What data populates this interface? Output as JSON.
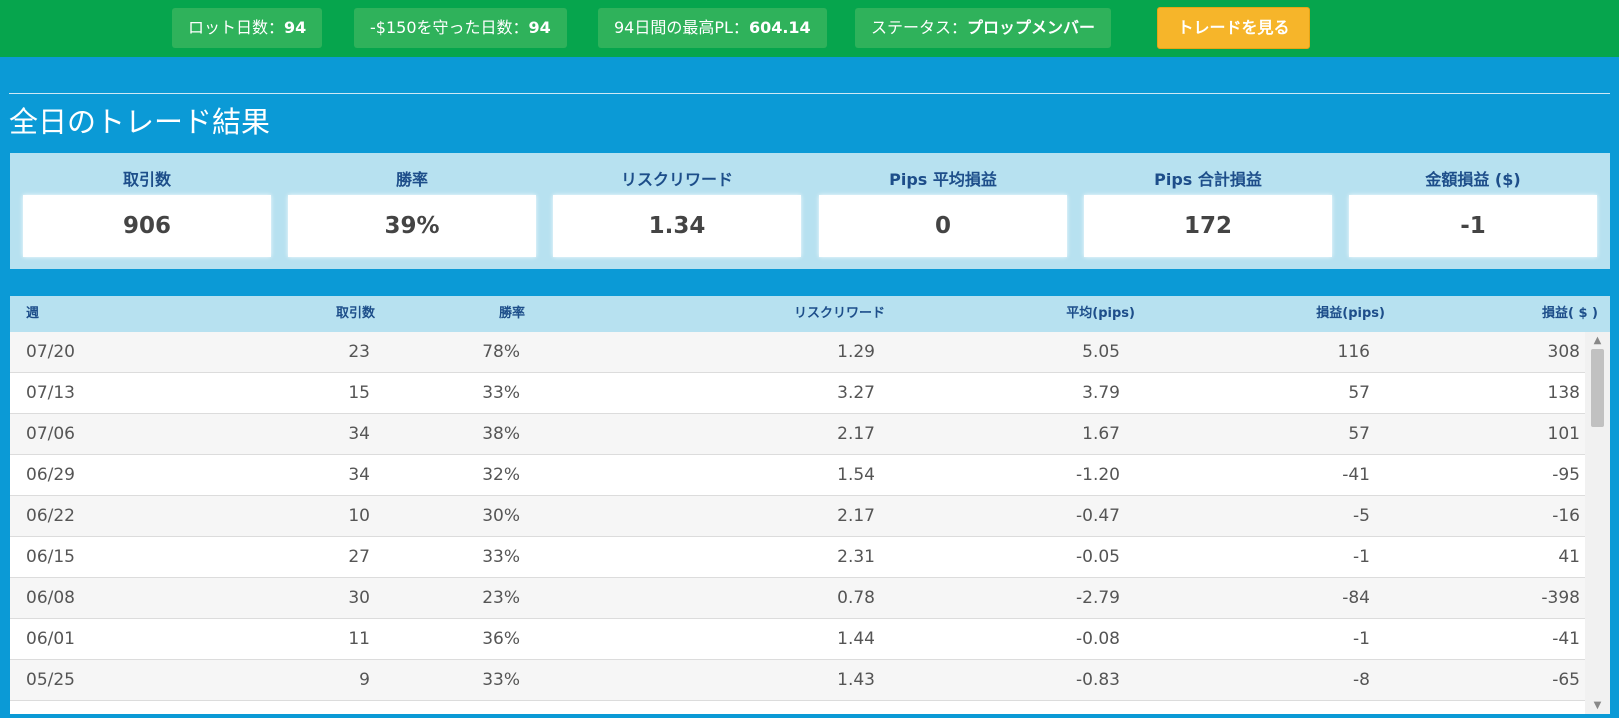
{
  "topbar": {
    "lot_days": {
      "label": "ロット日数：",
      "value": "94"
    },
    "protected_days": {
      "label": "-$150を守った日数：",
      "value": "94"
    },
    "best_pl": {
      "label_prefix": "94日間の最高PL：",
      "value": "604.14"
    },
    "status": {
      "label": "ステータス：",
      "value": "プロップメンバー"
    },
    "view_trades_label": "トレードを見る"
  },
  "section_title": "全日のトレード結果",
  "stats": [
    {
      "label": "取引数",
      "value": "906"
    },
    {
      "label": "勝率",
      "value": "39%"
    },
    {
      "label": "リスクリワード",
      "value": "1.34"
    },
    {
      "label": "Pips 平均損益",
      "value": "0"
    },
    {
      "label": "Pips 合計損益",
      "value": "172"
    },
    {
      "label": "金額損益 ($)",
      "value": "-1"
    }
  ],
  "table": {
    "headers": [
      "週",
      "取引数",
      "勝率",
      "リスクリワード",
      "平均(pips)",
      "損益(pips)",
      "損益( $ )"
    ],
    "rows": [
      [
        "07/20",
        "23",
        "78%",
        "1.29",
        "5.05",
        "116",
        "308"
      ],
      [
        "07/13",
        "15",
        "33%",
        "3.27",
        "3.79",
        "57",
        "138"
      ],
      [
        "07/06",
        "34",
        "38%",
        "2.17",
        "1.67",
        "57",
        "101"
      ],
      [
        "06/29",
        "34",
        "32%",
        "1.54",
        "-1.20",
        "-41",
        "-95"
      ],
      [
        "06/22",
        "10",
        "30%",
        "2.17",
        "-0.47",
        "-5",
        "-16"
      ],
      [
        "06/15",
        "27",
        "33%",
        "2.31",
        "-0.05",
        "-1",
        "41"
      ],
      [
        "06/08",
        "30",
        "23%",
        "0.78",
        "-2.79",
        "-84",
        "-398"
      ],
      [
        "06/01",
        "11",
        "36%",
        "1.44",
        "-0.08",
        "-1",
        "-41"
      ],
      [
        "05/25",
        "9",
        "33%",
        "1.43",
        "-0.83",
        "-8",
        "-65"
      ]
    ]
  },
  "colors": {
    "topbar": "#06a54d",
    "page_bg": "#0b9ad6",
    "panel_bg": "#b7e1f0",
    "accent_button": "#f6b52a",
    "header_text": "#1d4e8a"
  }
}
